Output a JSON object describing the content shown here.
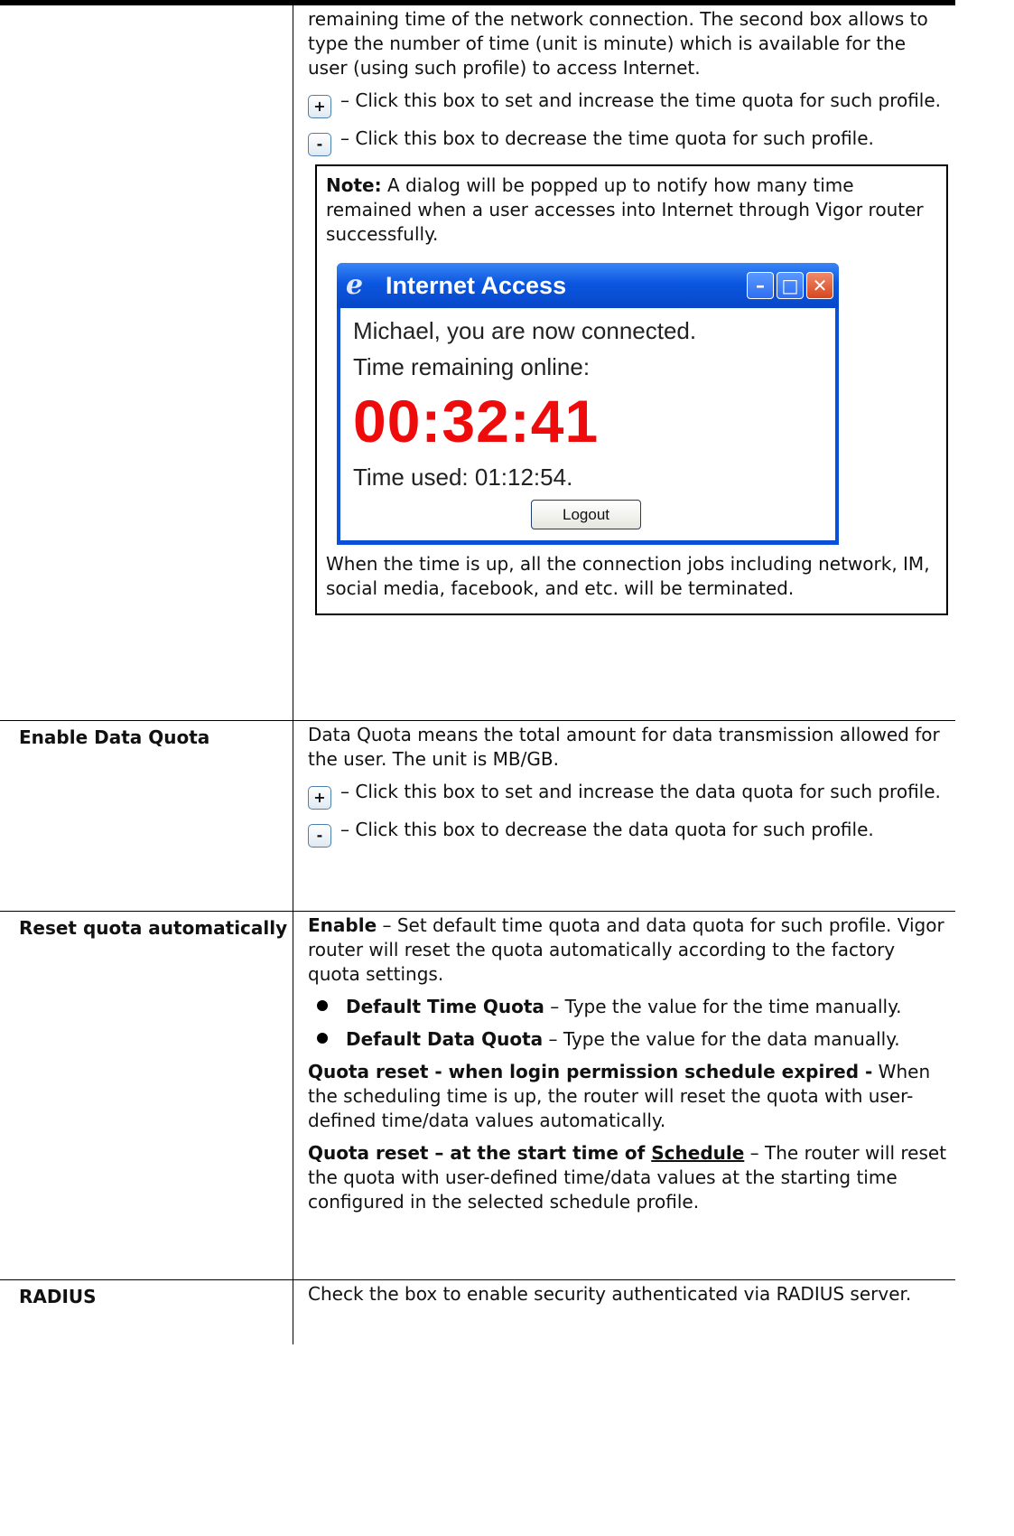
{
  "time_quota": {
    "intro": "remaining time of the network connection. The second box allows to type the number of time (unit is minute) which is available for the user (using such profile) to access Internet.",
    "plus_desc": "– Click this box to set and increase the time quota for such profile.",
    "minus_desc": "– Click this box to decrease the time quota for such profile.",
    "note_label": "Note:",
    "note_text": " A dialog will be popped up to notify how many time remained when a user accesses into Internet through Vigor router successfully.",
    "dialog": {
      "title": "Internet Access",
      "connected": "Michael, you are now connected.",
      "remaining_label": "Time remaining online:",
      "remaining_value": "00:32:41",
      "used": "Time used: 01:12:54.",
      "logout": "Logout"
    },
    "after_dialog": "When the time is up, all the connection jobs including network, IM, social media, facebook, and etc. will be terminated."
  },
  "icons": {
    "plus": "+",
    "minus": "-",
    "minimize": "–",
    "maximize": "□",
    "close": "✕",
    "ie": "e"
  },
  "data_quota": {
    "label": "Enable Data Quota",
    "intro": "Data Quota means the total amount for data transmission allowed for the user. The unit is MB/GB.",
    "plus_desc": "– Click this box to set and increase the data quota for such profile.",
    "minus_desc": "– Click this box to decrease the data quota for such profile."
  },
  "reset_quota": {
    "label": "Reset quota automatically",
    "enable_label": "Enable",
    "enable_text": " – Set default time quota and data quota for such profile. Vigor router will reset the quota automatically according to the factory quota settings.",
    "bullets": [
      {
        "label": "Default Time Quota",
        "text": " – Type the value for the time manually."
      },
      {
        "label": "Default Data Quota",
        "text": " – Type the value for the data manually."
      }
    ],
    "expired_label": "Quota reset - when login permission schedule expired -",
    "expired_text": " When the scheduling time is up, the router will reset the quota with user-defined time/data values automatically.",
    "schedule_label_pre": "Quota reset – at the start time of ",
    "schedule_link": "Schedule",
    "schedule_text": " – The router will reset the quota with user-defined time/data values at the starting time configured in the selected schedule profile."
  },
  "radius": {
    "label": "RADIUS",
    "text": "Check the box to enable security authenticated via RADIUS server."
  }
}
